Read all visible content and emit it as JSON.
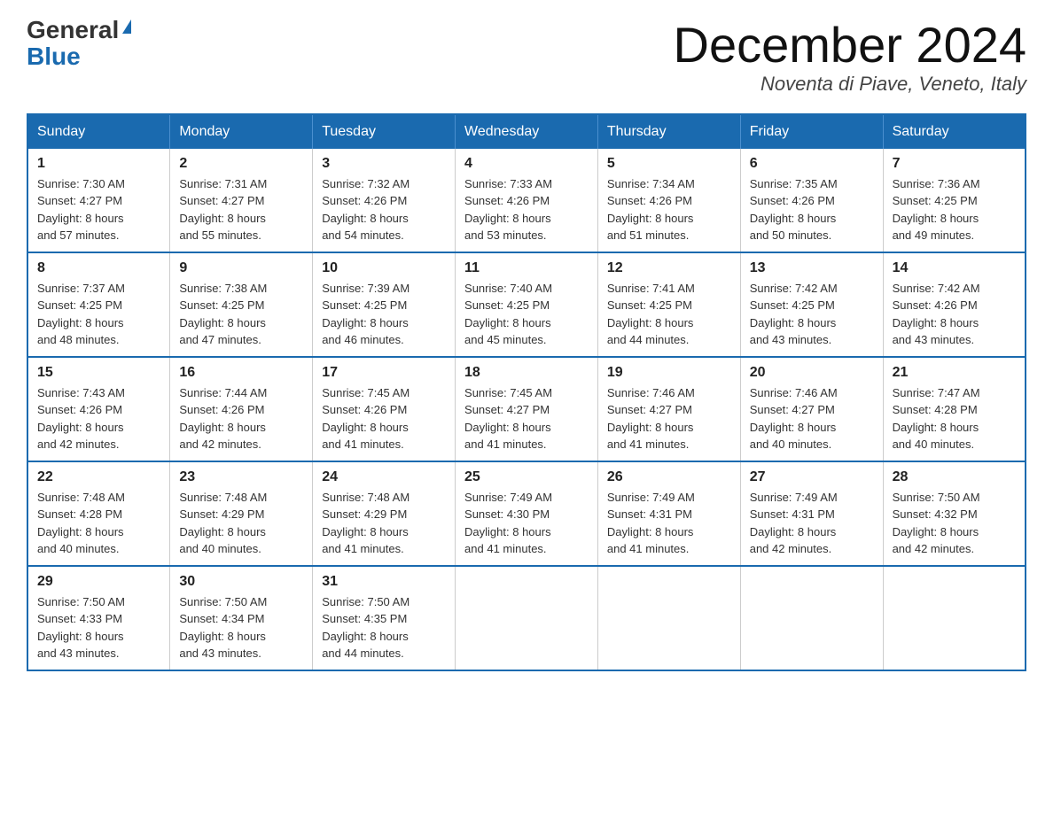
{
  "logo": {
    "general": "General",
    "blue": "Blue"
  },
  "header": {
    "month": "December 2024",
    "location": "Noventa di Piave, Veneto, Italy"
  },
  "weekdays": [
    "Sunday",
    "Monday",
    "Tuesday",
    "Wednesday",
    "Thursday",
    "Friday",
    "Saturday"
  ],
  "weeks": [
    [
      {
        "day": "1",
        "sunrise": "7:30 AM",
        "sunset": "4:27 PM",
        "daylight": "8 hours and 57 minutes."
      },
      {
        "day": "2",
        "sunrise": "7:31 AM",
        "sunset": "4:27 PM",
        "daylight": "8 hours and 55 minutes."
      },
      {
        "day": "3",
        "sunrise": "7:32 AM",
        "sunset": "4:26 PM",
        "daylight": "8 hours and 54 minutes."
      },
      {
        "day": "4",
        "sunrise": "7:33 AM",
        "sunset": "4:26 PM",
        "daylight": "8 hours and 53 minutes."
      },
      {
        "day": "5",
        "sunrise": "7:34 AM",
        "sunset": "4:26 PM",
        "daylight": "8 hours and 51 minutes."
      },
      {
        "day": "6",
        "sunrise": "7:35 AM",
        "sunset": "4:26 PM",
        "daylight": "8 hours and 50 minutes."
      },
      {
        "day": "7",
        "sunrise": "7:36 AM",
        "sunset": "4:25 PM",
        "daylight": "8 hours and 49 minutes."
      }
    ],
    [
      {
        "day": "8",
        "sunrise": "7:37 AM",
        "sunset": "4:25 PM",
        "daylight": "8 hours and 48 minutes."
      },
      {
        "day": "9",
        "sunrise": "7:38 AM",
        "sunset": "4:25 PM",
        "daylight": "8 hours and 47 minutes."
      },
      {
        "day": "10",
        "sunrise": "7:39 AM",
        "sunset": "4:25 PM",
        "daylight": "8 hours and 46 minutes."
      },
      {
        "day": "11",
        "sunrise": "7:40 AM",
        "sunset": "4:25 PM",
        "daylight": "8 hours and 45 minutes."
      },
      {
        "day": "12",
        "sunrise": "7:41 AM",
        "sunset": "4:25 PM",
        "daylight": "8 hours and 44 minutes."
      },
      {
        "day": "13",
        "sunrise": "7:42 AM",
        "sunset": "4:25 PM",
        "daylight": "8 hours and 43 minutes."
      },
      {
        "day": "14",
        "sunrise": "7:42 AM",
        "sunset": "4:26 PM",
        "daylight": "8 hours and 43 minutes."
      }
    ],
    [
      {
        "day": "15",
        "sunrise": "7:43 AM",
        "sunset": "4:26 PM",
        "daylight": "8 hours and 42 minutes."
      },
      {
        "day": "16",
        "sunrise": "7:44 AM",
        "sunset": "4:26 PM",
        "daylight": "8 hours and 42 minutes."
      },
      {
        "day": "17",
        "sunrise": "7:45 AM",
        "sunset": "4:26 PM",
        "daylight": "8 hours and 41 minutes."
      },
      {
        "day": "18",
        "sunrise": "7:45 AM",
        "sunset": "4:27 PM",
        "daylight": "8 hours and 41 minutes."
      },
      {
        "day": "19",
        "sunrise": "7:46 AM",
        "sunset": "4:27 PM",
        "daylight": "8 hours and 41 minutes."
      },
      {
        "day": "20",
        "sunrise": "7:46 AM",
        "sunset": "4:27 PM",
        "daylight": "8 hours and 40 minutes."
      },
      {
        "day": "21",
        "sunrise": "7:47 AM",
        "sunset": "4:28 PM",
        "daylight": "8 hours and 40 minutes."
      }
    ],
    [
      {
        "day": "22",
        "sunrise": "7:48 AM",
        "sunset": "4:28 PM",
        "daylight": "8 hours and 40 minutes."
      },
      {
        "day": "23",
        "sunrise": "7:48 AM",
        "sunset": "4:29 PM",
        "daylight": "8 hours and 40 minutes."
      },
      {
        "day": "24",
        "sunrise": "7:48 AM",
        "sunset": "4:29 PM",
        "daylight": "8 hours and 41 minutes."
      },
      {
        "day": "25",
        "sunrise": "7:49 AM",
        "sunset": "4:30 PM",
        "daylight": "8 hours and 41 minutes."
      },
      {
        "day": "26",
        "sunrise": "7:49 AM",
        "sunset": "4:31 PM",
        "daylight": "8 hours and 41 minutes."
      },
      {
        "day": "27",
        "sunrise": "7:49 AM",
        "sunset": "4:31 PM",
        "daylight": "8 hours and 42 minutes."
      },
      {
        "day": "28",
        "sunrise": "7:50 AM",
        "sunset": "4:32 PM",
        "daylight": "8 hours and 42 minutes."
      }
    ],
    [
      {
        "day": "29",
        "sunrise": "7:50 AM",
        "sunset": "4:33 PM",
        "daylight": "8 hours and 43 minutes."
      },
      {
        "day": "30",
        "sunrise": "7:50 AM",
        "sunset": "4:34 PM",
        "daylight": "8 hours and 43 minutes."
      },
      {
        "day": "31",
        "sunrise": "7:50 AM",
        "sunset": "4:35 PM",
        "daylight": "8 hours and 44 minutes."
      },
      null,
      null,
      null,
      null
    ]
  ],
  "labels": {
    "sunrise": "Sunrise:",
    "sunset": "Sunset:",
    "daylight": "Daylight:"
  }
}
